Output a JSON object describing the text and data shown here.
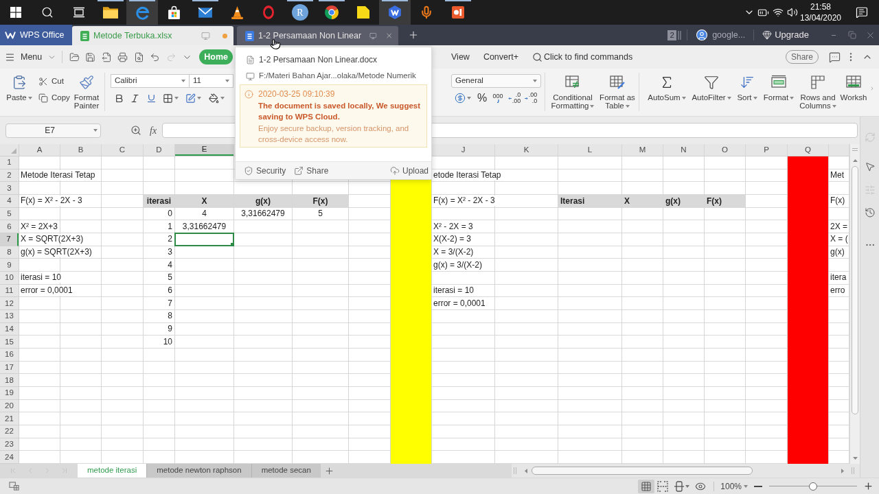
{
  "taskbar": {
    "apps": [
      {
        "kind": "start",
        "selected": false,
        "running": false
      },
      {
        "kind": "search",
        "selected": false,
        "running": false
      },
      {
        "kind": "taskview",
        "selected": false,
        "running": false
      },
      {
        "kind": "folder",
        "selected": false,
        "running": true
      },
      {
        "kind": "browser",
        "selected": true,
        "running": true
      },
      {
        "kind": "store",
        "selected": false,
        "running": false
      },
      {
        "kind": "mail",
        "selected": false,
        "running": true
      },
      {
        "kind": "cone",
        "selected": false,
        "running": false
      },
      {
        "kind": "ring",
        "selected": false,
        "running": false
      },
      {
        "kind": "letter",
        "label": "R",
        "selected": false,
        "running": true
      },
      {
        "kind": "wheel",
        "selected": false,
        "running": true
      },
      {
        "kind": "note",
        "selected": false,
        "running": false
      },
      {
        "kind": "office",
        "selected": true,
        "running": true
      },
      {
        "kind": "microphone",
        "selected": false,
        "running": false
      },
      {
        "kind": "slides",
        "selected": false,
        "running": true
      }
    ],
    "time": "21:58",
    "date": "13/04/2020"
  },
  "title_bar": {
    "tabs": [
      {
        "kind": "home",
        "label": "WPS Office",
        "selected": false,
        "hovered": false,
        "unsaved": false
      },
      {
        "kind": "sheet",
        "label": "Metode Terbuka.xlsx",
        "selected": true,
        "hovered": false,
        "unsaved": true
      },
      {
        "kind": "doc",
        "label": "1-2 Persamaan Non Linear",
        "selected": false,
        "hovered": true,
        "unsaved": false
      }
    ],
    "window_count": "2",
    "account": "google...",
    "upgrade": "Upgrade"
  },
  "tab_preview": {
    "file": "1-2 Persamaan Non Linear.docx",
    "path": "F:/Materi Bahan Ajar...olaka/Metode Numerik",
    "notice": {
      "time": "2020-03-25 09:10:39",
      "warning": "The document is saved locally, We suggest saving to WPS Cloud.",
      "detail": "Enjoy secure backup, version tracking, and cross-device access now."
    },
    "actions": [
      {
        "kind": "security",
        "label": "Security"
      },
      {
        "kind": "share",
        "label": "Share"
      },
      {
        "kind": "upload",
        "label": "Upload"
      }
    ]
  },
  "menu_bar": {
    "menu": "Menu",
    "quick_tools": [
      {
        "kind": "open",
        "disabled": false
      },
      {
        "kind": "save",
        "disabled": false
      },
      {
        "kind": "export",
        "disabled": false
      },
      {
        "kind": "print",
        "disabled": false
      },
      {
        "kind": "preview",
        "disabled": false
      },
      {
        "kind": "undo",
        "disabled": false
      },
      {
        "kind": "redo",
        "disabled": true
      },
      {
        "kind": "customize",
        "disabled": false
      }
    ],
    "tabs": [
      {
        "label": "Home",
        "selected": true
      },
      {
        "label": "View",
        "selected": false
      },
      {
        "label": "Convert+",
        "selected": false
      }
    ],
    "command_search": "Click to find commands",
    "share": "Share"
  },
  "ribbon": {
    "clipboard": [
      {
        "kind": "paste",
        "label": "Paste",
        "menu": true
      },
      {
        "kind": "cut",
        "label": "Cut",
        "menu": false
      },
      {
        "kind": "copy",
        "label": "Copy",
        "menu": false
      },
      {
        "kind": "painter",
        "label": "Format Painter"
      }
    ],
    "font": {
      "name": "Calibri",
      "size": "11"
    },
    "font_tools": [
      {
        "kind": "bold",
        "menu": false
      },
      {
        "kind": "italic",
        "menu": false
      },
      {
        "kind": "underline",
        "menu": false
      },
      {
        "kind": "borders",
        "menu": true
      },
      {
        "kind": "style",
        "menu": true
      },
      {
        "kind": "fill",
        "menu": true
      }
    ],
    "number_format": "General",
    "number_tools": [
      {
        "kind": "currency",
        "menu": true
      },
      {
        "kind": "percent",
        "label": "%"
      },
      {
        "kind": "thousands",
        "label": "000"
      },
      {
        "kind": "increase",
        "lines": [
          ".0",
          ".00"
        ]
      },
      {
        "kind": "decrease",
        "lines": [
          ".00",
          ".0"
        ]
      }
    ],
    "commands": [
      {
        "kind": "conditional",
        "label": "Conditional Formatting",
        "menu": true
      },
      {
        "kind": "table",
        "label": "Format as Table",
        "menu": true
      },
      {
        "kind": "sum",
        "label": "AutoSum",
        "menu": true
      },
      {
        "kind": "filter",
        "label": "AutoFilter",
        "menu": true
      },
      {
        "kind": "sort",
        "label": "Sort",
        "menu": true
      },
      {
        "kind": "format",
        "label": "Format",
        "menu": true
      },
      {
        "kind": "rowscols",
        "label": "Rows and Columns",
        "menu": true
      },
      {
        "kind": "worksheet",
        "label": "Worksh",
        "menu": false
      }
    ]
  },
  "formula_bar": {
    "name_box": "E7",
    "fx": "fx"
  },
  "sheet": {
    "columns": [
      {
        "label": "A",
        "selected": false
      },
      {
        "label": "B",
        "selected": false
      },
      {
        "label": "C",
        "selected": false
      },
      {
        "label": "D",
        "selected": false
      },
      {
        "label": "E",
        "selected": true
      },
      null,
      null,
      null,
      {
        "color": "#ffff00"
      },
      {
        "label": "J",
        "selected": false
      },
      {
        "label": "K",
        "selected": false
      },
      {
        "label": "L",
        "selected": false
      },
      {
        "label": "M",
        "selected": false
      },
      {
        "label": "N",
        "selected": false
      },
      {
        "label": "O",
        "selected": false
      },
      {
        "label": "P",
        "selected": false
      },
      {
        "label": "Q",
        "selected": false,
        "color": "#ff0000"
      },
      {
        "selected": false
      }
    ],
    "rows": [
      {
        "label": "1",
        "selected": false
      },
      {
        "label": "2",
        "selected": false,
        "cells": [
          {
            "kind": "text",
            "text": "Metode Iterasi Tetap"
          },
          null,
          null,
          null,
          null,
          null,
          null,
          null,
          null,
          {
            "kind": "text",
            "text": "etode Iterasi Tetap"
          },
          null,
          null,
          null,
          null,
          null,
          null,
          null,
          {
            "kind": "text",
            "text": "Met"
          }
        ]
      },
      {
        "label": "3",
        "selected": false
      },
      {
        "label": "4",
        "selected": false,
        "cells": [
          {
            "kind": "text",
            "text": "F(x) = X² - 2X - 3"
          },
          null,
          null,
          {
            "kind": "heading",
            "text": "iterasi"
          },
          {
            "kind": "heading",
            "text": "X"
          },
          {
            "kind": "heading",
            "text": "g(x)"
          },
          {
            "kind": "heading",
            "text": "F(x)"
          },
          null,
          null,
          {
            "kind": "text",
            "text": "F(x) = X² - 2X - 3"
          },
          null,
          {
            "kind": "caption",
            "text": "Iterasi"
          },
          {
            "kind": "caption",
            "text": "X"
          },
          {
            "kind": "caption",
            "text": "g(x)"
          },
          {
            "kind": "caption",
            "text": "F(x)"
          },
          null,
          null,
          {
            "kind": "text",
            "text": "F(x)"
          }
        ]
      },
      {
        "label": "5",
        "selected": false,
        "cells": [
          null,
          null,
          null,
          {
            "kind": "number",
            "text": "0"
          },
          {
            "kind": "value",
            "text": "4"
          },
          {
            "kind": "value",
            "text": "3,31662479"
          },
          {
            "kind": "value",
            "text": "5"
          }
        ]
      },
      {
        "label": "6",
        "selected": false,
        "cells": [
          {
            "kind": "text",
            "text": "X² = 2X+3"
          },
          null,
          null,
          {
            "kind": "number",
            "text": "1"
          },
          {
            "kind": "value",
            "text": "3,31662479"
          },
          null,
          null,
          null,
          null,
          {
            "kind": "text",
            "text": "X² - 2X = 3"
          },
          null,
          null,
          null,
          null,
          null,
          null,
          null,
          {
            "kind": "text",
            "text": "2X ="
          }
        ]
      },
      {
        "label": "7",
        "selected": true,
        "cells": [
          {
            "kind": "text",
            "text": "X = SQRT(2X+3)"
          },
          null,
          null,
          {
            "kind": "number",
            "text": "2"
          },
          null,
          null,
          null,
          null,
          null,
          {
            "kind": "text",
            "text": "X(X-2) = 3"
          },
          null,
          null,
          null,
          null,
          null,
          null,
          null,
          {
            "kind": "text",
            "text": "X = ("
          }
        ]
      },
      {
        "label": "8",
        "selected": false,
        "cells": [
          {
            "kind": "text",
            "text": "g(x) = SQRT(2X+3)"
          },
          null,
          null,
          {
            "kind": "number",
            "text": "3"
          },
          null,
          null,
          null,
          null,
          null,
          {
            "kind": "text",
            "text": "X = 3/(X-2)"
          },
          null,
          null,
          null,
          null,
          null,
          null,
          null,
          {
            "kind": "text",
            "text": "g(x)"
          }
        ]
      },
      {
        "label": "9",
        "selected": false,
        "cells": [
          null,
          null,
          null,
          {
            "kind": "number",
            "text": "4"
          },
          null,
          null,
          null,
          null,
          null,
          {
            "kind": "text",
            "text": "g(x) = 3/(X-2)"
          }
        ]
      },
      {
        "label": "10",
        "selected": false,
        "cells": [
          {
            "kind": "text",
            "text": "iterasi = 10"
          },
          null,
          null,
          {
            "kind": "number",
            "text": "5"
          },
          null,
          null,
          null,
          null,
          null,
          null,
          null,
          null,
          null,
          null,
          null,
          null,
          null,
          {
            "kind": "text",
            "text": "itera"
          }
        ]
      },
      {
        "label": "11",
        "selected": false,
        "cells": [
          {
            "kind": "text",
            "text": "error = 0,0001"
          },
          null,
          null,
          {
            "kind": "number",
            "text": "6"
          },
          null,
          null,
          null,
          null,
          null,
          {
            "kind": "text",
            "text": "iterasi = 10"
          },
          null,
          null,
          null,
          null,
          null,
          null,
          null,
          {
            "kind": "text",
            "text": "erro"
          }
        ]
      },
      {
        "label": "12",
        "selected": false,
        "cells": [
          null,
          null,
          null,
          {
            "kind": "number",
            "text": "7"
          },
          null,
          null,
          null,
          null,
          null,
          {
            "kind": "text",
            "text": "error = 0,0001"
          }
        ]
      },
      {
        "label": "13",
        "selected": false,
        "cells": [
          null,
          null,
          null,
          {
            "kind": "number",
            "text": "8"
          }
        ]
      },
      {
        "label": "14",
        "selected": false,
        "cells": [
          null,
          null,
          null,
          {
            "kind": "number",
            "text": "9"
          }
        ]
      },
      {
        "label": "15",
        "selected": false,
        "cells": [
          null,
          null,
          null,
          {
            "kind": "number",
            "text": "10"
          }
        ]
      },
      {
        "label": "16",
        "selected": false
      },
      {
        "label": "17",
        "selected": false
      },
      {
        "label": "18",
        "selected": false
      },
      {
        "label": "19",
        "selected": false
      },
      {
        "label": "20",
        "selected": false
      },
      {
        "label": "21",
        "selected": false
      },
      {
        "label": "22",
        "selected": false
      },
      {
        "label": "23",
        "selected": false
      },
      {
        "label": "24",
        "selected": false
      }
    ]
  },
  "side_panel": [
    {
      "kind": "sync",
      "disabled": true
    },
    {
      "kind": "pointer",
      "disabled": false
    },
    {
      "kind": "sliders",
      "disabled": true
    },
    {
      "kind": "history",
      "disabled": false
    },
    {
      "kind": "more",
      "disabled": false
    }
  ],
  "sheet_nav": [
    {
      "kind": "first",
      "disabled": true
    },
    {
      "kind": "previous",
      "disabled": true
    },
    {
      "kind": "next",
      "disabled": true
    },
    {
      "kind": "last",
      "disabled": true
    }
  ],
  "sheet_tabs": [
    {
      "label": "metode iterasi",
      "selected": true
    },
    {
      "label": "metode newton raphson",
      "selected": false
    },
    {
      "label": "metode secan",
      "selected": false
    }
  ],
  "status_bar": {
    "views": [
      {
        "kind": "normal",
        "selected": true
      },
      {
        "kind": "pagebreak",
        "selected": false
      },
      {
        "kind": "layout",
        "selected": false
      },
      {
        "kind": "reading",
        "selected": false
      }
    ],
    "zoom": "100%",
    "zoom_slider": {
      "level": 0.5
    }
  }
}
